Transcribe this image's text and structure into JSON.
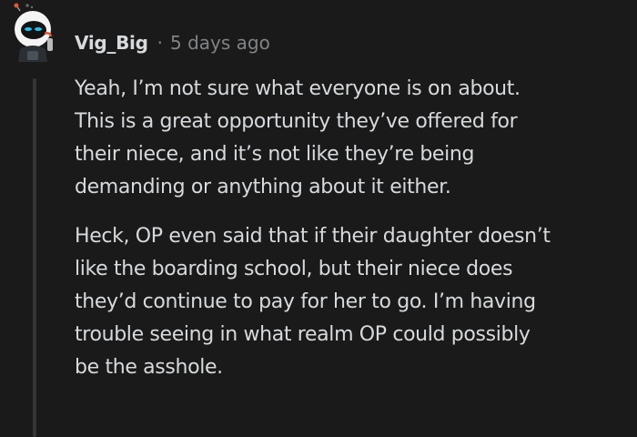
{
  "comment": {
    "username": "Vig_Big",
    "separator": "·",
    "timestamp": "5 days ago",
    "avatar_icon": "robot-avatar-icon",
    "paragraphs": [
      {
        "lines": [
          "Yeah, I’m not sure what everyone is on about.",
          "This is a great opportunity they’ve offered for",
          "their niece, and it’s not like they’re being",
          "demanding or anything about it either."
        ]
      },
      {
        "lines": [
          "Heck, OP even said that if their daughter doesn’t",
          "like the boarding school, but their niece does",
          "they’d continue to pay for her to go. I’m having",
          "trouble seeing in what realm OP could possibly",
          "be the asshole."
        ]
      }
    ]
  },
  "colors": {
    "background": "#1a1a1b",
    "text": "#d7dadc",
    "meta": "#818384",
    "thread_line": "#343536"
  }
}
